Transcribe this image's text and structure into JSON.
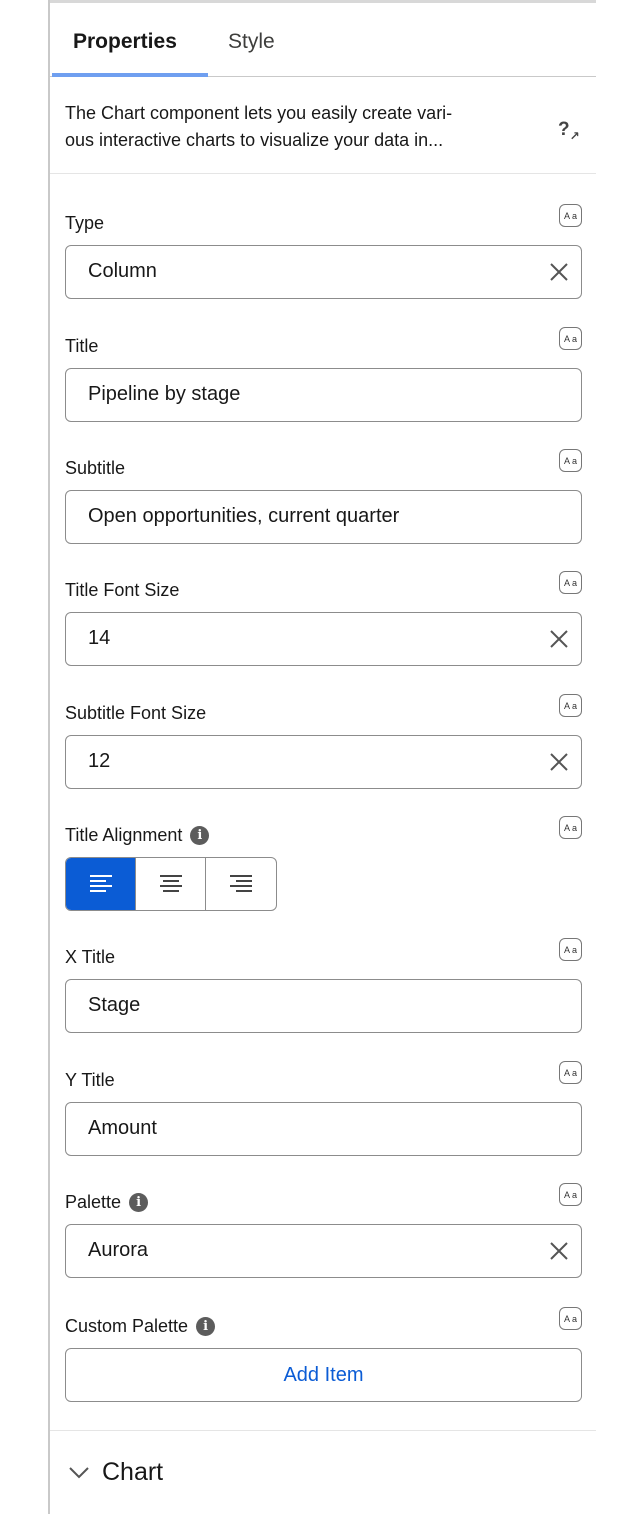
{
  "tabs": [
    {
      "label": "Properties",
      "active": true
    },
    {
      "label": "Style",
      "active": false
    }
  ],
  "description": {
    "line1": "The Chart component lets you easily create vari-",
    "line2": "ous interactive charts to visualize your data in...",
    "help_icon": "help-external-icon"
  },
  "fields": {
    "type": {
      "label": "Type",
      "value": "Column"
    },
    "title": {
      "label": "Title",
      "value": "Pipeline by stage"
    },
    "subtitle": {
      "label": "Subtitle",
      "value": "Open opportunities, current quarter"
    },
    "title_font_size": {
      "label": "Title Font Size",
      "value": "14"
    },
    "subtitle_font_size": {
      "label": "Subtitle Font Size",
      "value": "12"
    },
    "title_alignment": {
      "label": "Title Alignment",
      "options": [
        "left",
        "center",
        "right"
      ],
      "selected": "left"
    },
    "x_title": {
      "label": "X Title",
      "value": "Stage"
    },
    "y_title": {
      "label": "Y Title",
      "value": "Amount"
    },
    "palette": {
      "label": "Palette",
      "value": "Aurora"
    },
    "custom_palette": {
      "label": "Custom Palette",
      "button": "Add Item"
    }
  },
  "formula_icon_text": "A a",
  "info_icon_text": "i",
  "section": {
    "label": "Chart",
    "icon": "chevron-down-icon"
  },
  "colors": {
    "accent": "#0b5cd5",
    "tab_underline": "#6f9ff0"
  }
}
